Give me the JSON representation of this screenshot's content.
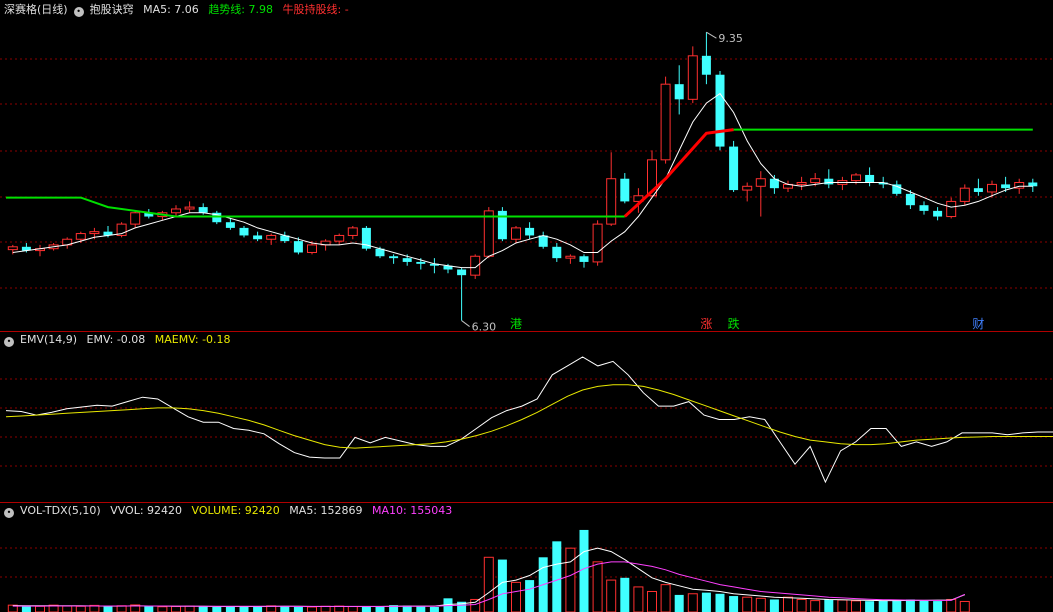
{
  "header_main": {
    "title": "深赛格(日线)",
    "indicator": "抱股诀窍",
    "ma5_label": "MA5: 7.06",
    "trend_label": "趋势线: 7.98",
    "bull_label": "牛股持股线: -"
  },
  "header_emv": {
    "name": "EMV(14,9)",
    "emv": "EMV: -0.08",
    "maemv": "MAEMV: -0.18"
  },
  "header_vol": {
    "name": "VOL-TDX(5,10)",
    "vvol": "VVOL: 92420",
    "volume": "VOLUME: 92420",
    "ma5": "MA5: 152869",
    "ma10": "MA10: 155043"
  },
  "colors": {
    "up": "#ff3030",
    "down": "#40ffff",
    "trend_green": "#00e000",
    "trend_red": "#ff0000",
    "ma_line": "#ffffff",
    "maemv": "#e8e800",
    "vol_ma10": "#ff40ff",
    "grid": "#8b0000",
    "divider": "#b00000"
  },
  "chart_data": [
    {
      "type": "candlestick",
      "title": "深赛格(日线)",
      "ylim": [
        6.2,
        9.5
      ],
      "max_label": "9.35",
      "min_label": "6.30",
      "candles": [
        [
          7.05,
          7.1,
          7.0,
          7.08
        ],
        [
          7.08,
          7.12,
          7.02,
          7.04
        ],
        [
          7.04,
          7.1,
          6.98,
          7.06
        ],
        [
          7.06,
          7.12,
          7.04,
          7.1
        ],
        [
          7.1,
          7.18,
          7.06,
          7.16
        ],
        [
          7.16,
          7.24,
          7.12,
          7.22
        ],
        [
          7.22,
          7.28,
          7.16,
          7.24
        ],
        [
          7.24,
          7.3,
          7.18,
          7.2
        ],
        [
          7.2,
          7.34,
          7.18,
          7.32
        ],
        [
          7.32,
          7.46,
          7.28,
          7.44
        ],
        [
          7.44,
          7.48,
          7.38,
          7.4
        ],
        [
          7.4,
          7.46,
          7.36,
          7.44
        ],
        [
          7.44,
          7.52,
          7.4,
          7.48
        ],
        [
          7.48,
          7.56,
          7.44,
          7.5
        ],
        [
          7.5,
          7.54,
          7.42,
          7.44
        ],
        [
          7.44,
          7.46,
          7.32,
          7.34
        ],
        [
          7.34,
          7.38,
          7.26,
          7.28
        ],
        [
          7.28,
          7.3,
          7.18,
          7.2
        ],
        [
          7.2,
          7.24,
          7.14,
          7.16
        ],
        [
          7.16,
          7.22,
          7.1,
          7.2
        ],
        [
          7.2,
          7.24,
          7.12,
          7.14
        ],
        [
          7.14,
          7.18,
          7.0,
          7.02
        ],
        [
          7.02,
          7.14,
          7.0,
          7.1
        ],
        [
          7.1,
          7.16,
          7.04,
          7.14
        ],
        [
          7.14,
          7.22,
          7.1,
          7.2
        ],
        [
          7.2,
          7.3,
          7.16,
          7.28
        ],
        [
          7.28,
          7.3,
          7.04,
          7.06
        ],
        [
          7.06,
          7.08,
          6.96,
          6.98
        ],
        [
          6.98,
          7.0,
          6.9,
          6.96
        ],
        [
          6.96,
          7.0,
          6.88,
          6.92
        ],
        [
          6.92,
          6.96,
          6.84,
          6.9
        ],
        [
          6.9,
          6.96,
          6.8,
          6.88
        ],
        [
          6.88,
          6.9,
          6.8,
          6.84
        ],
        [
          6.84,
          6.86,
          6.3,
          6.78
        ],
        [
          6.78,
          7.0,
          6.74,
          6.98
        ],
        [
          6.98,
          7.5,
          6.96,
          7.46
        ],
        [
          7.46,
          7.5,
          7.14,
          7.16
        ],
        [
          7.16,
          7.3,
          7.12,
          7.28
        ],
        [
          7.28,
          7.34,
          7.16,
          7.2
        ],
        [
          7.2,
          7.24,
          7.06,
          7.08
        ],
        [
          7.08,
          7.12,
          6.92,
          6.96
        ],
        [
          6.96,
          7.0,
          6.9,
          6.98
        ],
        [
          6.98,
          7.0,
          6.86,
          6.92
        ],
        [
          6.92,
          7.36,
          6.88,
          7.32
        ],
        [
          7.32,
          8.08,
          7.3,
          7.8
        ],
        [
          7.8,
          7.86,
          7.54,
          7.56
        ],
        [
          7.56,
          7.7,
          7.44,
          7.62
        ],
        [
          7.62,
          8.1,
          7.6,
          8.0
        ],
        [
          8.0,
          8.88,
          7.96,
          8.8
        ],
        [
          8.8,
          9.0,
          8.48,
          8.64
        ],
        [
          8.64,
          9.2,
          8.6,
          9.1
        ],
        [
          9.1,
          9.35,
          8.8,
          8.9
        ],
        [
          8.9,
          8.94,
          8.1,
          8.14
        ],
        [
          8.14,
          8.2,
          7.66,
          7.68
        ],
        [
          7.68,
          7.76,
          7.56,
          7.72
        ],
        [
          7.72,
          7.88,
          7.4,
          7.8
        ],
        [
          7.8,
          7.84,
          7.64,
          7.7
        ],
        [
          7.7,
          7.78,
          7.66,
          7.74
        ],
        [
          7.74,
          7.82,
          7.68,
          7.76
        ],
        [
          7.76,
          7.86,
          7.72,
          7.8
        ],
        [
          7.8,
          7.9,
          7.7,
          7.74
        ],
        [
          7.74,
          7.82,
          7.68,
          7.78
        ],
        [
          7.78,
          7.86,
          7.74,
          7.84
        ],
        [
          7.84,
          7.92,
          7.72,
          7.76
        ],
        [
          7.76,
          7.82,
          7.7,
          7.74
        ],
        [
          7.74,
          7.78,
          7.62,
          7.64
        ],
        [
          7.64,
          7.68,
          7.48,
          7.52
        ],
        [
          7.52,
          7.56,
          7.42,
          7.46
        ],
        [
          7.46,
          7.5,
          7.36,
          7.4
        ],
        [
          7.4,
          7.6,
          7.38,
          7.56
        ],
        [
          7.56,
          7.74,
          7.52,
          7.7
        ],
        [
          7.7,
          7.8,
          7.62,
          7.66
        ],
        [
          7.66,
          7.78,
          7.6,
          7.74
        ],
        [
          7.74,
          7.82,
          7.66,
          7.7
        ],
        [
          7.7,
          7.8,
          7.64,
          7.76
        ],
        [
          7.76,
          7.8,
          7.66,
          7.72
        ]
      ],
      "ma5": [
        7.02,
        7.04,
        7.06,
        7.08,
        7.1,
        7.14,
        7.18,
        7.2,
        7.22,
        7.28,
        7.32,
        7.36,
        7.4,
        7.44,
        7.44,
        7.42,
        7.38,
        7.34,
        7.28,
        7.24,
        7.2,
        7.16,
        7.12,
        7.1,
        7.1,
        7.12,
        7.1,
        7.06,
        7.02,
        6.98,
        6.94,
        6.9,
        6.88,
        6.86,
        6.86,
        6.98,
        7.04,
        7.12,
        7.16,
        7.2,
        7.16,
        7.1,
        7.02,
        7.02,
        7.14,
        7.24,
        7.4,
        7.6,
        7.8,
        8.1,
        8.4,
        8.6,
        8.7,
        8.5,
        8.2,
        7.96,
        7.8,
        7.74,
        7.72,
        7.74,
        7.76,
        7.76,
        7.76,
        7.76,
        7.76,
        7.72,
        7.66,
        7.6,
        7.54,
        7.5,
        7.52,
        7.56,
        7.62,
        7.68,
        7.72,
        7.72
      ],
      "trend_green_left": [
        [
          0,
          7.6
        ],
        [
          5,
          7.6
        ],
        [
          7,
          7.5
        ],
        [
          10,
          7.44
        ],
        [
          12,
          7.4
        ],
        [
          45,
          7.4
        ]
      ],
      "trend_red": [
        [
          45,
          7.4
        ],
        [
          48,
          7.8
        ],
        [
          51,
          8.28
        ],
        [
          53,
          8.32
        ]
      ],
      "trend_green_right": [
        [
          53,
          8.32
        ],
        [
          75,
          8.32
        ]
      ],
      "markers": [
        {
          "i": 37,
          "label": "港",
          "color": "#00e000"
        },
        {
          "i": 51,
          "label": "涨",
          "color": "#ff3030"
        },
        {
          "i": 53,
          "label": "跌",
          "color": "#00e000"
        },
        {
          "i": 71,
          "label": "财",
          "color": "#4080ff"
        }
      ]
    },
    {
      "type": "line",
      "title": "EMV(14,9)",
      "ylim": [
        -1.6,
        1.8
      ],
      "series": [
        {
          "name": "EMV",
          "values": [
            0.4,
            0.38,
            0.3,
            0.36,
            0.44,
            0.48,
            0.52,
            0.5,
            0.6,
            0.7,
            0.66,
            0.46,
            0.26,
            0.14,
            0.14,
            0.0,
            -0.04,
            -0.12,
            -0.34,
            -0.54,
            -0.64,
            -0.66,
            -0.66,
            -0.2,
            -0.32,
            -0.2,
            -0.28,
            -0.36,
            -0.4,
            -0.4,
            -0.24,
            0.0,
            0.24,
            0.4,
            0.5,
            0.66,
            1.2,
            1.4,
            1.6,
            1.4,
            1.5,
            1.2,
            0.8,
            0.5,
            0.5,
            0.6,
            0.3,
            0.2,
            0.2,
            0.26,
            0.2,
            -0.3,
            -0.8,
            -0.4,
            -1.2,
            -0.5,
            -0.3,
            0.0,
            0.0,
            -0.4,
            -0.3,
            -0.4,
            -0.3,
            -0.1,
            -0.1,
            -0.1,
            -0.14,
            -0.1,
            -0.08,
            -0.08
          ]
        },
        {
          "name": "MAEMV",
          "values": [
            0.26,
            0.28,
            0.3,
            0.32,
            0.34,
            0.36,
            0.38,
            0.4,
            0.42,
            0.44,
            0.46,
            0.46,
            0.44,
            0.4,
            0.34,
            0.26,
            0.18,
            0.08,
            -0.04,
            -0.16,
            -0.26,
            -0.36,
            -0.42,
            -0.44,
            -0.42,
            -0.4,
            -0.38,
            -0.36,
            -0.34,
            -0.3,
            -0.24,
            -0.16,
            -0.06,
            0.06,
            0.2,
            0.36,
            0.54,
            0.72,
            0.86,
            0.94,
            0.98,
            0.98,
            0.94,
            0.86,
            0.76,
            0.64,
            0.52,
            0.4,
            0.28,
            0.16,
            0.04,
            -0.08,
            -0.18,
            -0.26,
            -0.3,
            -0.34,
            -0.36,
            -0.36,
            -0.34,
            -0.3,
            -0.26,
            -0.24,
            -0.22,
            -0.2,
            -0.19,
            -0.18,
            -0.18,
            -0.18,
            -0.18,
            -0.18
          ]
        }
      ]
    },
    {
      "type": "bar",
      "title": "VOL-TDX(5,10)",
      "ylim": [
        0,
        800000
      ],
      "values": [
        60000,
        55000,
        50000,
        60000,
        52000,
        50000,
        58000,
        48000,
        55000,
        62000,
        50000,
        46000,
        48000,
        52000,
        50000,
        44000,
        46000,
        52000,
        48000,
        54000,
        50000,
        46000,
        44000,
        50000,
        52000,
        48000,
        46000,
        52000,
        60000,
        56000,
        50000,
        44000,
        120000,
        90000,
        110000,
        480000,
        460000,
        260000,
        280000,
        480000,
        620000,
        560000,
        720000,
        440000,
        280000,
        300000,
        220000,
        180000,
        240000,
        150000,
        160000,
        170000,
        160000,
        140000,
        130000,
        120000,
        110000,
        130000,
        110000,
        100000,
        110000,
        105000,
        98000,
        95000,
        100000,
        105000,
        110000,
        98000,
        96000,
        110000,
        92420
      ],
      "series": [
        {
          "name": "MA5",
          "values": [
            56000,
            55000,
            55000,
            55000,
            55000,
            54000,
            53000,
            52000,
            52000,
            54000,
            53000,
            52000,
            51000,
            51000,
            50000,
            48000,
            48000,
            48000,
            48000,
            49000,
            50000,
            50000,
            48000,
            48000,
            48000,
            48000,
            48000,
            48000,
            50000,
            52000,
            52000,
            52000,
            66000,
            72000,
            85000,
            170000,
            260000,
            280000,
            320000,
            390000,
            420000,
            440000,
            530000,
            560000,
            530000,
            460000,
            380000,
            300000,
            260000,
            230000,
            200000,
            190000,
            180000,
            160000,
            150000,
            140000,
            130000,
            125000,
            120000,
            115000,
            110000,
            108000,
            104000,
            102000,
            100000,
            100000,
            102000,
            102000,
            104000,
            104000,
            152869
          ]
        },
        {
          "name": "MA10",
          "values": [
            52000,
            52000,
            52000,
            53000,
            53000,
            53000,
            53000,
            53000,
            53000,
            53000,
            53000,
            53000,
            52000,
            52000,
            51000,
            50000,
            50000,
            50000,
            50000,
            50000,
            50000,
            49000,
            49000,
            49000,
            49000,
            49000,
            49000,
            49000,
            49000,
            50000,
            50000,
            50000,
            56000,
            60000,
            66000,
            110000,
            160000,
            180000,
            200000,
            240000,
            280000,
            320000,
            380000,
            420000,
            440000,
            440000,
            420000,
            400000,
            370000,
            330000,
            300000,
            270000,
            240000,
            220000,
            200000,
            180000,
            170000,
            160000,
            150000,
            140000,
            130000,
            124000,
            118000,
            112000,
            108000,
            106000,
            104000,
            103000,
            102000,
            102000,
            155043
          ]
        }
      ]
    }
  ]
}
